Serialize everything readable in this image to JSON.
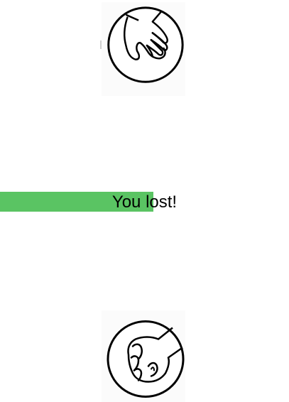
{
  "game": {
    "opponent_hand": "paper",
    "player_hand": "rock",
    "result_text": "You lost!",
    "timer_fraction": 0.53
  },
  "icons": {
    "opponent": "paper-hand-icon",
    "player": "rock-fist-icon"
  },
  "colors": {
    "timer_bar": "#5ac463",
    "background": "#ffffff",
    "outline": "#000000"
  }
}
